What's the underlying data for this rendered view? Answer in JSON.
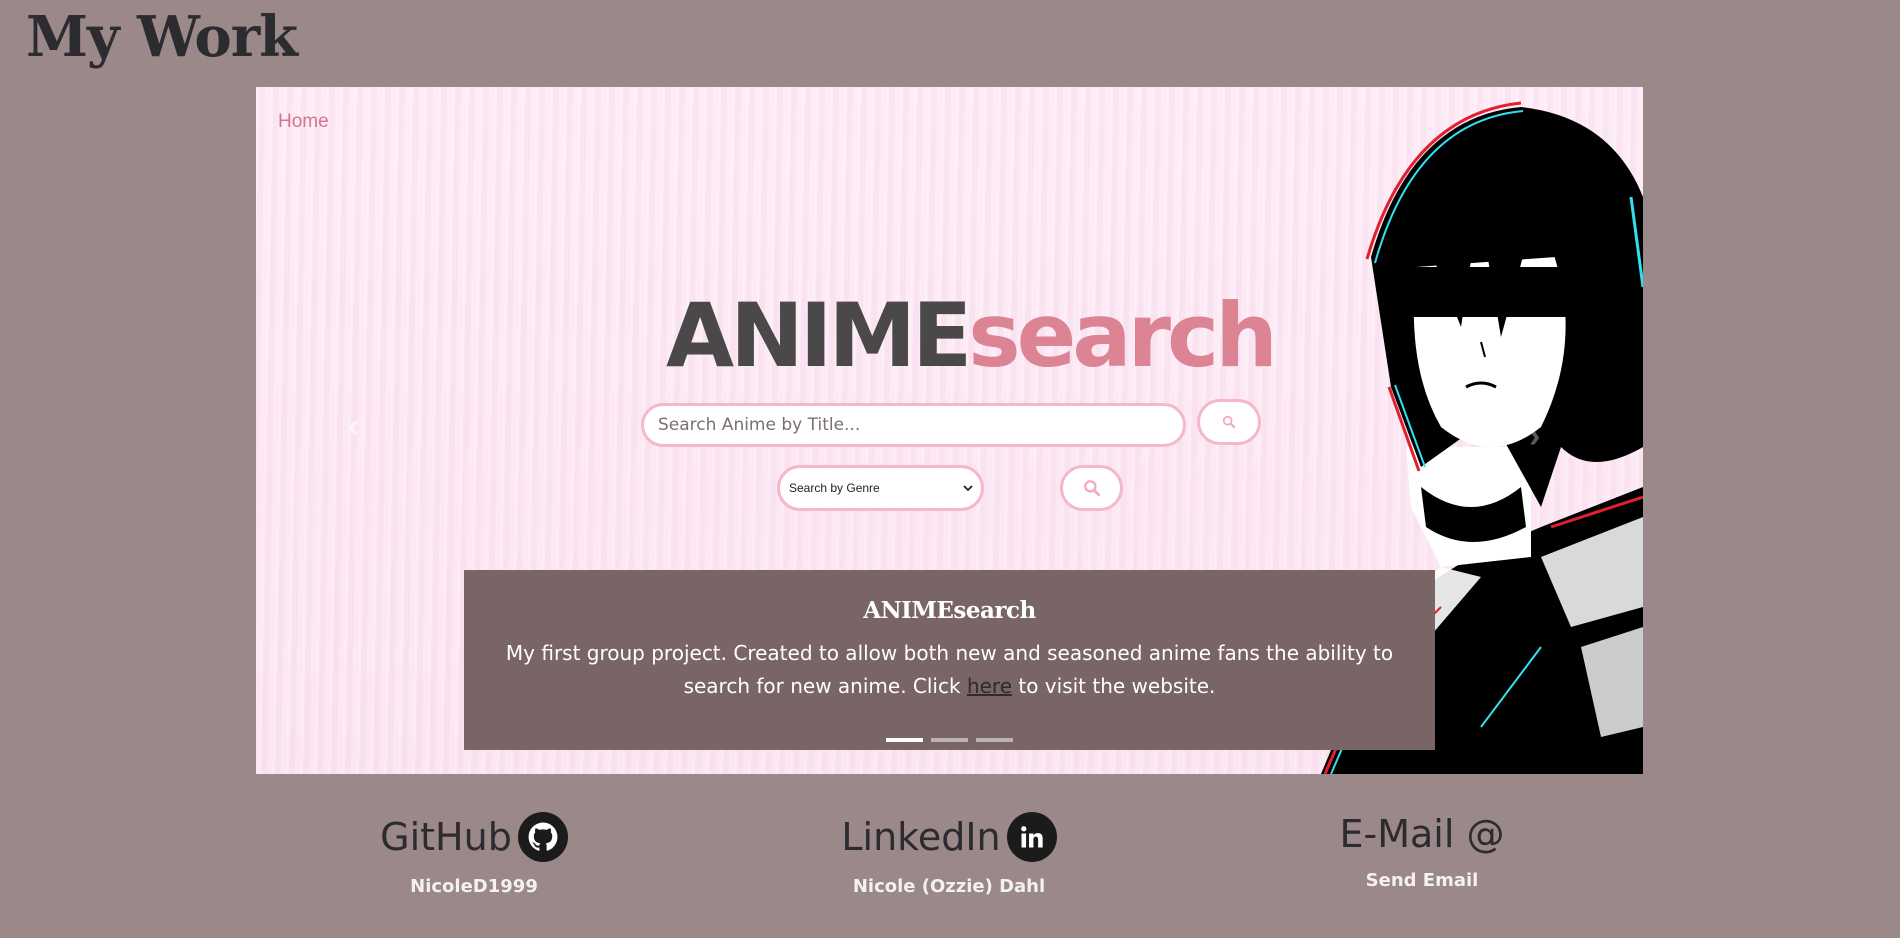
{
  "page": {
    "title": "My Work"
  },
  "carousel": {
    "nav_home": "Home",
    "brand": {
      "part1": "ANIME",
      "part2": "search"
    },
    "search": {
      "placeholder": "Search Anime by Title..."
    },
    "genre_select": {
      "selected": "Search by Genre"
    },
    "caption": {
      "title": "ANIMEsearch",
      "text_before": "My first group project. Created to allow both new and seasoned anime fans the ability to search for new anime. Click ",
      "link_text": "here",
      "text_after": " to visit the website."
    },
    "slides": {
      "count": 3,
      "active_index": 0
    }
  },
  "contacts": [
    {
      "label": "GitHub",
      "icon": "github-icon",
      "value": "NicoleD1999"
    },
    {
      "label": "LinkedIn",
      "icon": "linkedin-icon",
      "value": "Nicole (Ozzie) Dahl"
    },
    {
      "label": "E-Mail @",
      "icon": "at-sign",
      "value": "Send Email"
    }
  ],
  "colors": {
    "background": "#9b8889",
    "accent_pink": "#dc8394",
    "caption_bg": "#7a6566",
    "title_dark": "#2b2b30"
  }
}
